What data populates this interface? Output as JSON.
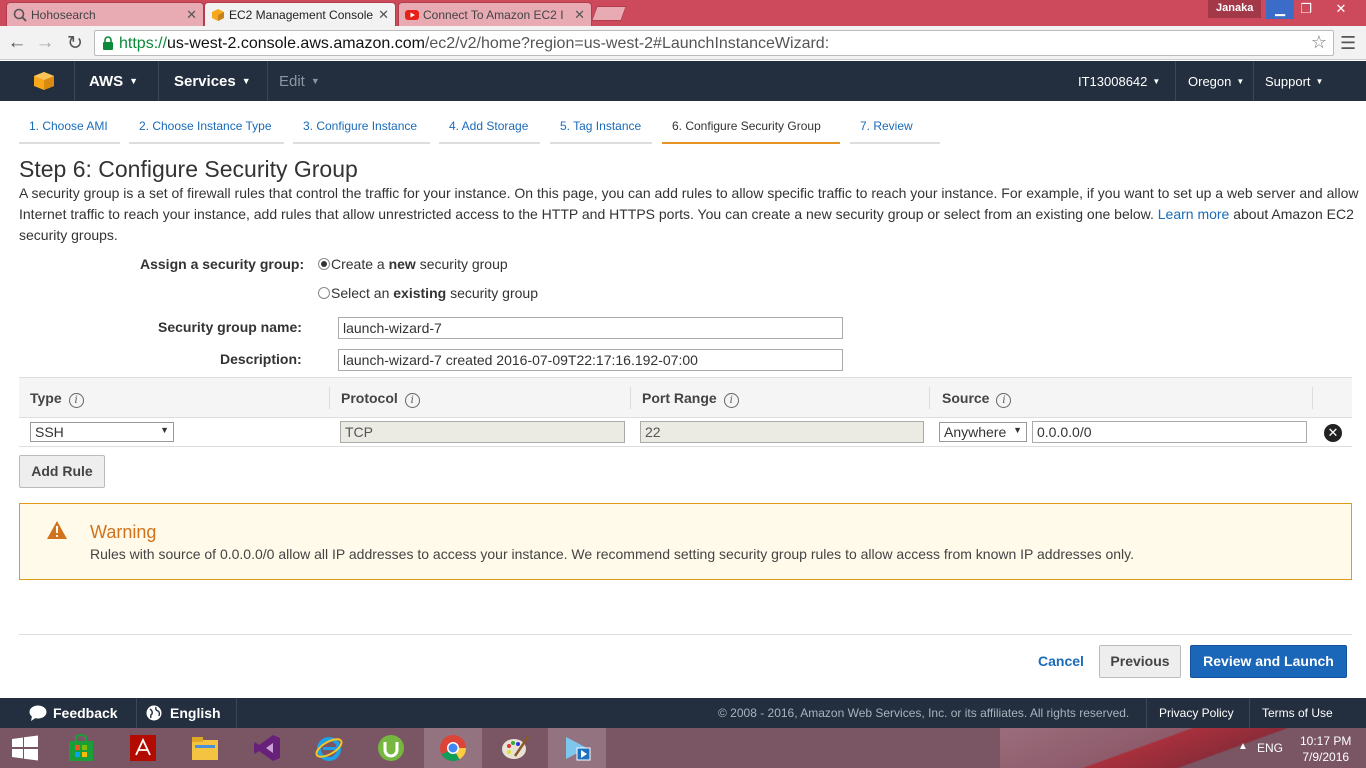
{
  "browser": {
    "tabs": [
      {
        "title": "Hohosearch",
        "icon": "search-icon"
      },
      {
        "title": "EC2 Management Console",
        "icon": "aws-cube-icon"
      },
      {
        "title": "Connect To Amazon EC2 I",
        "icon": "youtube-icon"
      }
    ],
    "user": "Janaka",
    "url_scheme": "https://",
    "url_host": "us-west-2.console.aws.amazon.com",
    "url_path": "/ec2/v2/home?region=us-west-2#LaunchInstanceWizard:"
  },
  "aws_header": {
    "brand": "AWS",
    "services": "Services",
    "edit": "Edit",
    "account": "IT13008642",
    "region": "Oregon",
    "support": "Support"
  },
  "wizard": {
    "steps": [
      "1. Choose AMI",
      "2. Choose Instance Type",
      "3. Configure Instance",
      "4. Add Storage",
      "5. Tag Instance",
      "6. Configure Security Group",
      "7. Review"
    ],
    "active_step": 6
  },
  "page": {
    "title": "Step 6: Configure Security Group",
    "intro": "A security group is a set of firewall rules that control the traffic for your instance. On this page, you can add rules to allow specific traffic to reach your instance. For example, if you want to set up a web server and allow Internet traffic to reach your instance, add rules that allow unrestricted access to the HTTP and HTTPS ports. You can create a new security group or select from an existing one below.",
    "learn_more": "Learn more",
    "intro_tail": "about Amazon EC2 security groups."
  },
  "form": {
    "assign_label": "Assign a security group:",
    "option_new_pre": "Create a",
    "option_new_bold": "new",
    "option_new_post": "security group",
    "option_existing_pre": "Select an",
    "option_existing_bold": "existing",
    "option_existing_post": "security group",
    "selected_option": "new",
    "name_label": "Security group name:",
    "name_value": "launch-wizard-7",
    "desc_label": "Description:",
    "desc_value": "launch-wizard-7 created 2016-07-09T22:17:16.192-07:00"
  },
  "rules": {
    "headers": {
      "type": "Type",
      "protocol": "Protocol",
      "port_range": "Port Range",
      "source": "Source"
    },
    "rows": [
      {
        "type": "SSH",
        "protocol": "TCP",
        "port_range": "22",
        "source_mode": "Anywhere",
        "source_cidr": "0.0.0.0/0"
      }
    ],
    "add_rule": "Add Rule"
  },
  "warning": {
    "title": "Warning",
    "text": "Rules with source of 0.0.0.0/0 allow all IP addresses to access your instance. We recommend setting security group rules to allow access from known IP addresses only."
  },
  "actions": {
    "cancel": "Cancel",
    "previous": "Previous",
    "review_launch": "Review and Launch"
  },
  "footer": {
    "feedback": "Feedback",
    "language": "English",
    "copyright": "© 2008 - 2016, Amazon Web Services, Inc. or its affiliates. All rights reserved.",
    "privacy": "Privacy Policy",
    "terms": "Terms of Use"
  },
  "taskbar": {
    "apps": [
      "windows-start-icon",
      "store-icon",
      "acrobat-icon",
      "file-explorer-icon",
      "visual-studio-icon",
      "internet-explorer-icon",
      "utorrent-icon",
      "chrome-icon",
      "paint-icon",
      "media-player-icon"
    ],
    "language": "ENG",
    "time": "10:17 PM",
    "date": "7/9/2016"
  },
  "colors": {
    "aws_nav": "#232f3e",
    "link": "#1a6bb8",
    "primary_button": "#1a66b8",
    "active_step_underline": "#e79426",
    "warning_border": "#e09b1a",
    "warning_title": "#d2721b",
    "chrome_titlebar": "#cc4a5b"
  }
}
